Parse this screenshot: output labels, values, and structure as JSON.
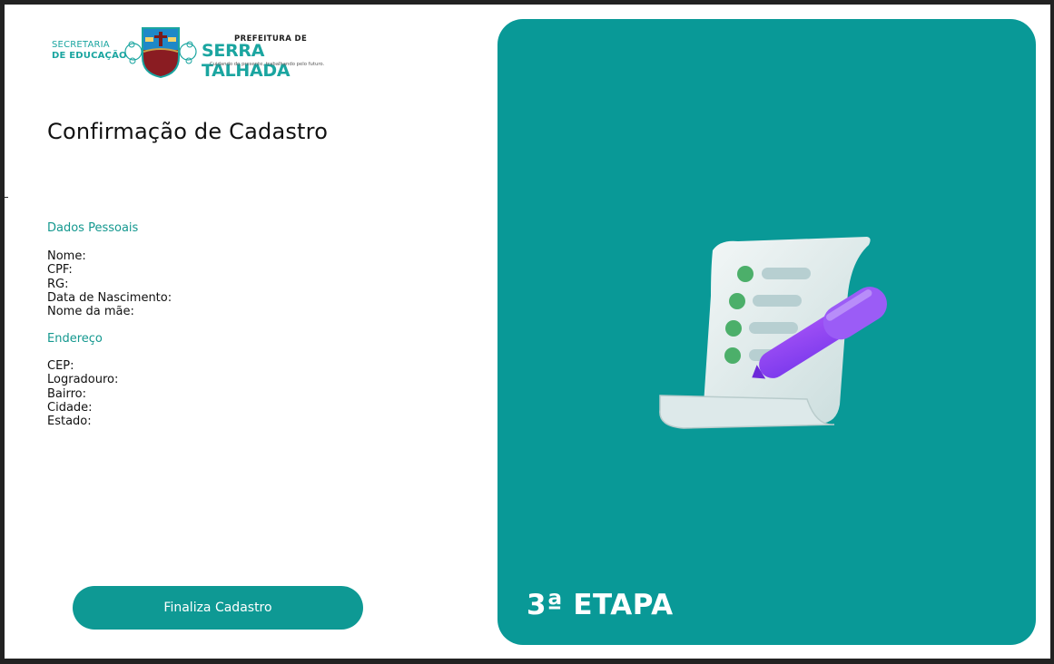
{
  "header": {
    "secretaria_line1": "SECRETARIA",
    "secretaria_line2": "DE EDUCAÇÃO",
    "prefeitura": "PREFEITURA DE",
    "city": "SERRA TALHADA",
    "slogan": "Cuidando do presente, trabalhando pelo futuro."
  },
  "page_title": "Confirmação de Cadastro",
  "personal": {
    "title": "Dados Pessoais",
    "fields": [
      "Nome:",
      "CPF:",
      "RG:",
      "Data de Nascimento:",
      "Nome da mãe:"
    ]
  },
  "address": {
    "title": "Endereço",
    "fields": [
      "CEP:",
      "Logradouro:",
      "Bairro:",
      "Cidade:",
      "Estado:"
    ]
  },
  "finalize_button": "Finaliza Cadastro",
  "stage_label": "3ª ETAPA",
  "colors": {
    "accent": "#0e9994",
    "panel": "#099997",
    "pen": "#8b5cf6",
    "check": "#4caf6a"
  },
  "icons": {
    "illustration": "document-checklist-pen-icon",
    "crest": "municipal-crest-icon"
  }
}
